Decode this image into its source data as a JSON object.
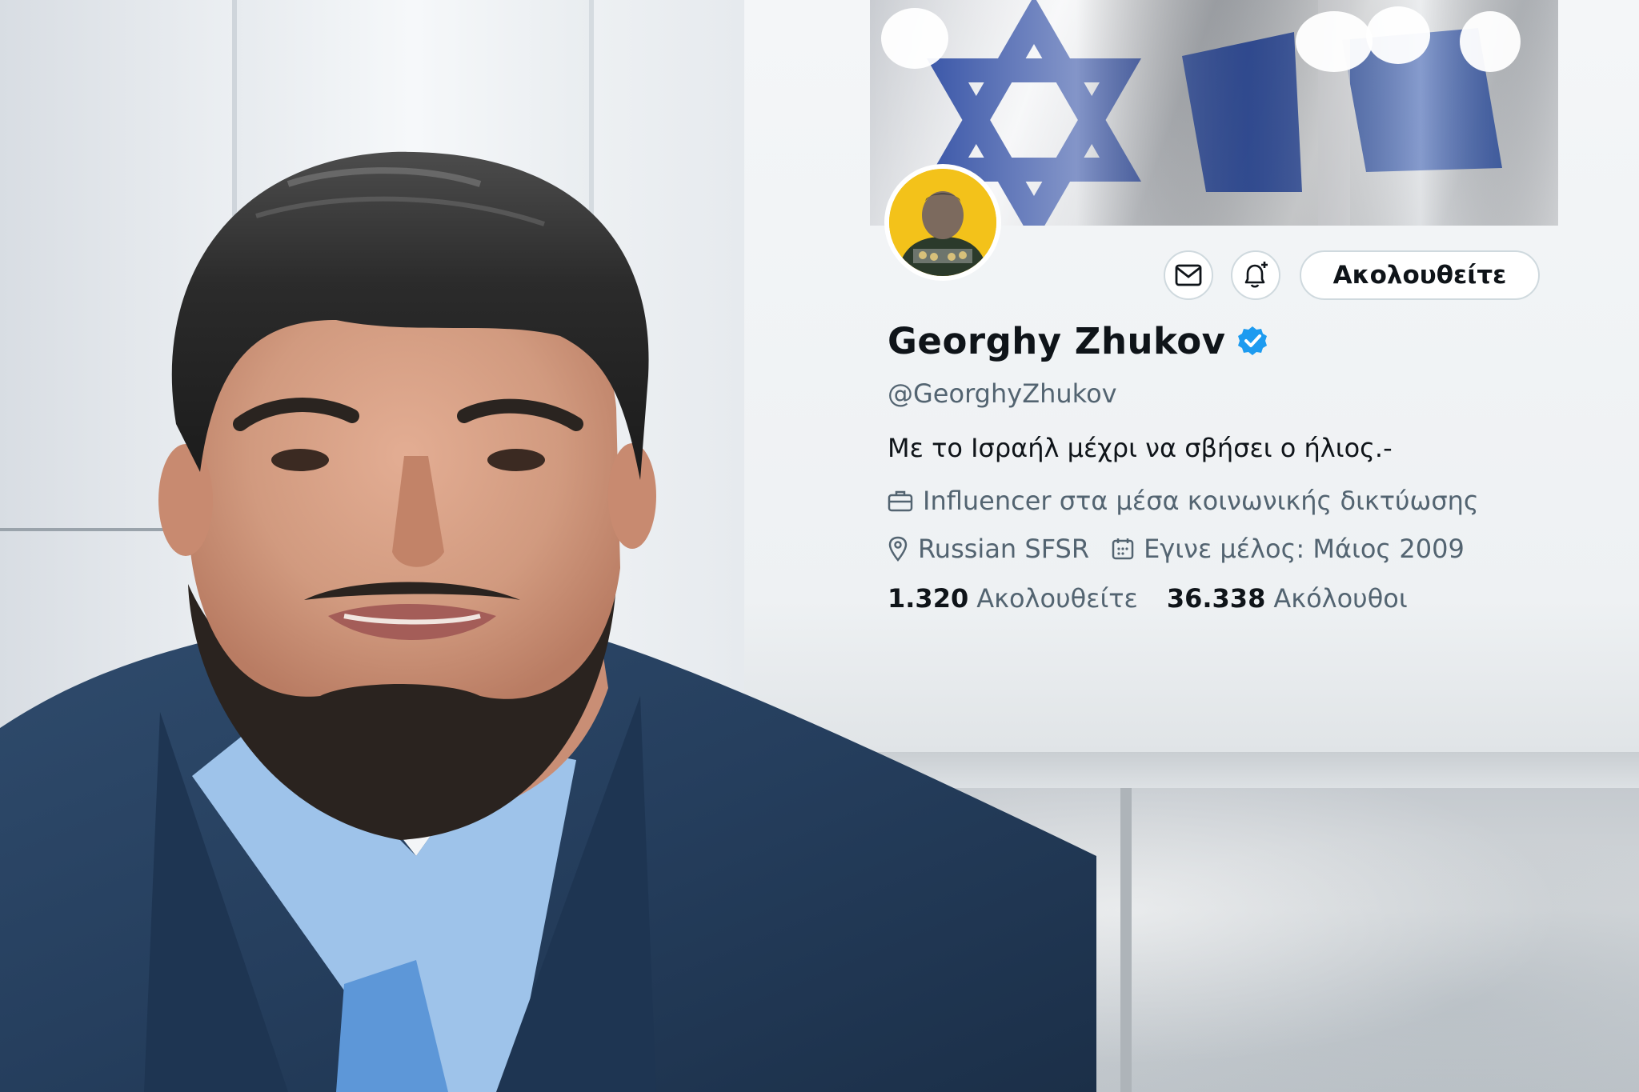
{
  "profile": {
    "display_name": "Georghy Zhukov",
    "handle": "@GeorghyZhukov",
    "bio": "Με το Ισραήλ μέχρι να σβήσει ο ήλιος.-",
    "profession": "Influencer στα μέσα κοινωνικής δικτύωσης",
    "location": "Russian SFSR",
    "joined": "Εγινε μέλος: Μάιος 2009",
    "following_count": "1.320",
    "following_label": "Ακολουθείτε",
    "followers_count": "36.338",
    "followers_label": "Ακόλουθοι",
    "verified": true
  },
  "actions": {
    "message_icon": "envelope-icon",
    "notify_icon": "bell-plus-icon",
    "follow_label": "Ακολουθείτε"
  },
  "banner": {
    "subject": "israeli-flag-star-of-david",
    "colors": {
      "blue": "#1f3f9c",
      "white": "#f4f5f7"
    }
  },
  "colors": {
    "verified": "#1d9bf0",
    "text": "#0f1419",
    "muted": "#536471",
    "border": "#cfd9de",
    "avatar_bg": "#f3c21a"
  }
}
